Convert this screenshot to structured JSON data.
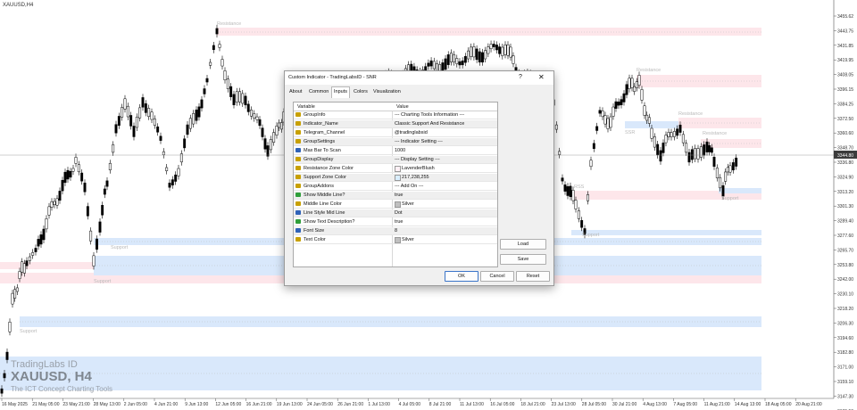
{
  "chart": {
    "symbol_header": "XAUUSD,H4",
    "watermark": {
      "brand": "TradingLabs ID",
      "pair": "XAUUSD, H4",
      "tagline": "The ICT Concept Charting Tools"
    },
    "price_labels": [
      "3455.62",
      "3443.75",
      "3431.85",
      "3419.95",
      "3408.05",
      "3396.15",
      "3384.25",
      "3372.50",
      "3360.60",
      "3348.70",
      "3336.80",
      "3324.90",
      "3313.20",
      "3301.30",
      "3289.40",
      "3277.60",
      "3265.70",
      "3253.80",
      "3242.00",
      "3230.10",
      "3218.20",
      "3206.30",
      "3194.60",
      "3182.80",
      "3171.00",
      "3159.10",
      "3147.30",
      "3135.50"
    ],
    "current_price": "3344.80",
    "time_labels": [
      "16 May 2025",
      "21 May 05:00",
      "23 May 21:00",
      "28 May 13:00",
      "2 Jun 05:00",
      "4 Jun 21:00",
      "9 Jun 13:00",
      "12 Jun 05:00",
      "16 Jun 21:00",
      "19 Jun 13:00",
      "24 Jun 05:00",
      "26 Jun 21:00",
      "1 Jul 13:00",
      "4 Jul 05:00",
      "8 Jul 21:00",
      "11 Jul 13:00",
      "16 Jul 05:00",
      "18 Jul 21:00",
      "23 Jul 13:00",
      "28 Jul 05:00",
      "30 Jul 21:00",
      "4 Aug 13:00",
      "7 Aug 05:00",
      "11 Aug 21:00",
      "14 Aug 13:00",
      "18 Aug 05:00",
      "20 Aug 21:00"
    ],
    "zone_labels": {
      "resistance": "Resistance",
      "support": "Support",
      "ssr": "SSR",
      "rss": "RSS"
    },
    "colors": {
      "resistance_zone": "#fde6ea",
      "support_zone": "#d9e8fb",
      "candle": "#000000"
    }
  },
  "dialog": {
    "title": "Custom Indicator - TradingLabsID - SNR",
    "help": "?",
    "close": "✕",
    "tabs": [
      "About",
      "Common",
      "Inputs",
      "Colors",
      "Visualization"
    ],
    "active_tab": "Inputs",
    "columns": {
      "variable": "Variable",
      "value": "Value"
    },
    "rows": [
      {
        "icon": "abc-icon",
        "variable": "GroupInfo",
        "value": "--- Charting Tools Information ---"
      },
      {
        "icon": "abc-icon",
        "variable": "Indicator_Name",
        "value": "Classic Support And Resistance"
      },
      {
        "icon": "abc-icon",
        "variable": "Telegram_Channel",
        "value": "@tradinglabsid"
      },
      {
        "icon": "abc-icon",
        "variable": "GroupSettings",
        "value": "--- Indicator Setting ---"
      },
      {
        "icon": "int-icon",
        "variable": "Max Bar To Scan",
        "value": "1000"
      },
      {
        "icon": "abc-icon",
        "variable": "GroupDisplay",
        "value": "--- Display Setting ---"
      },
      {
        "icon": "color-icon",
        "variable": "Resistance Zone Color",
        "value": "LavenderBlush",
        "swatch": "#fff0f5"
      },
      {
        "icon": "color-icon",
        "variable": "Support Zone Color",
        "value": "217,238,255",
        "swatch": "#d9eeff"
      },
      {
        "icon": "abc-icon",
        "variable": "GroupAddons",
        "value": "--- Add On ---"
      },
      {
        "icon": "bool-icon",
        "variable": "Show Middle Line?",
        "value": "true"
      },
      {
        "icon": "color-icon",
        "variable": "Middle Line Color",
        "value": "Silver",
        "swatch": "#c0c0c0"
      },
      {
        "icon": "enum-icon",
        "variable": "Line Style Mid Line",
        "value": "Dot"
      },
      {
        "icon": "bool-icon",
        "variable": "Show Text Description?",
        "value": "true"
      },
      {
        "icon": "int-icon",
        "variable": "Font Size",
        "value": "8"
      },
      {
        "icon": "color-icon",
        "variable": "Text Color",
        "value": "Silver",
        "swatch": "#c0c0c0"
      }
    ],
    "icon_colors": {
      "abc-icon": "#c8a000",
      "int-icon": "#2f62b8",
      "color-icon": "#c8a000",
      "bool-icon": "#2f9e3a",
      "enum-icon": "#2f62b8"
    },
    "buttons": {
      "load": "Load",
      "save": "Save",
      "ok": "OK",
      "cancel": "Cancel",
      "reset": "Reset"
    }
  }
}
